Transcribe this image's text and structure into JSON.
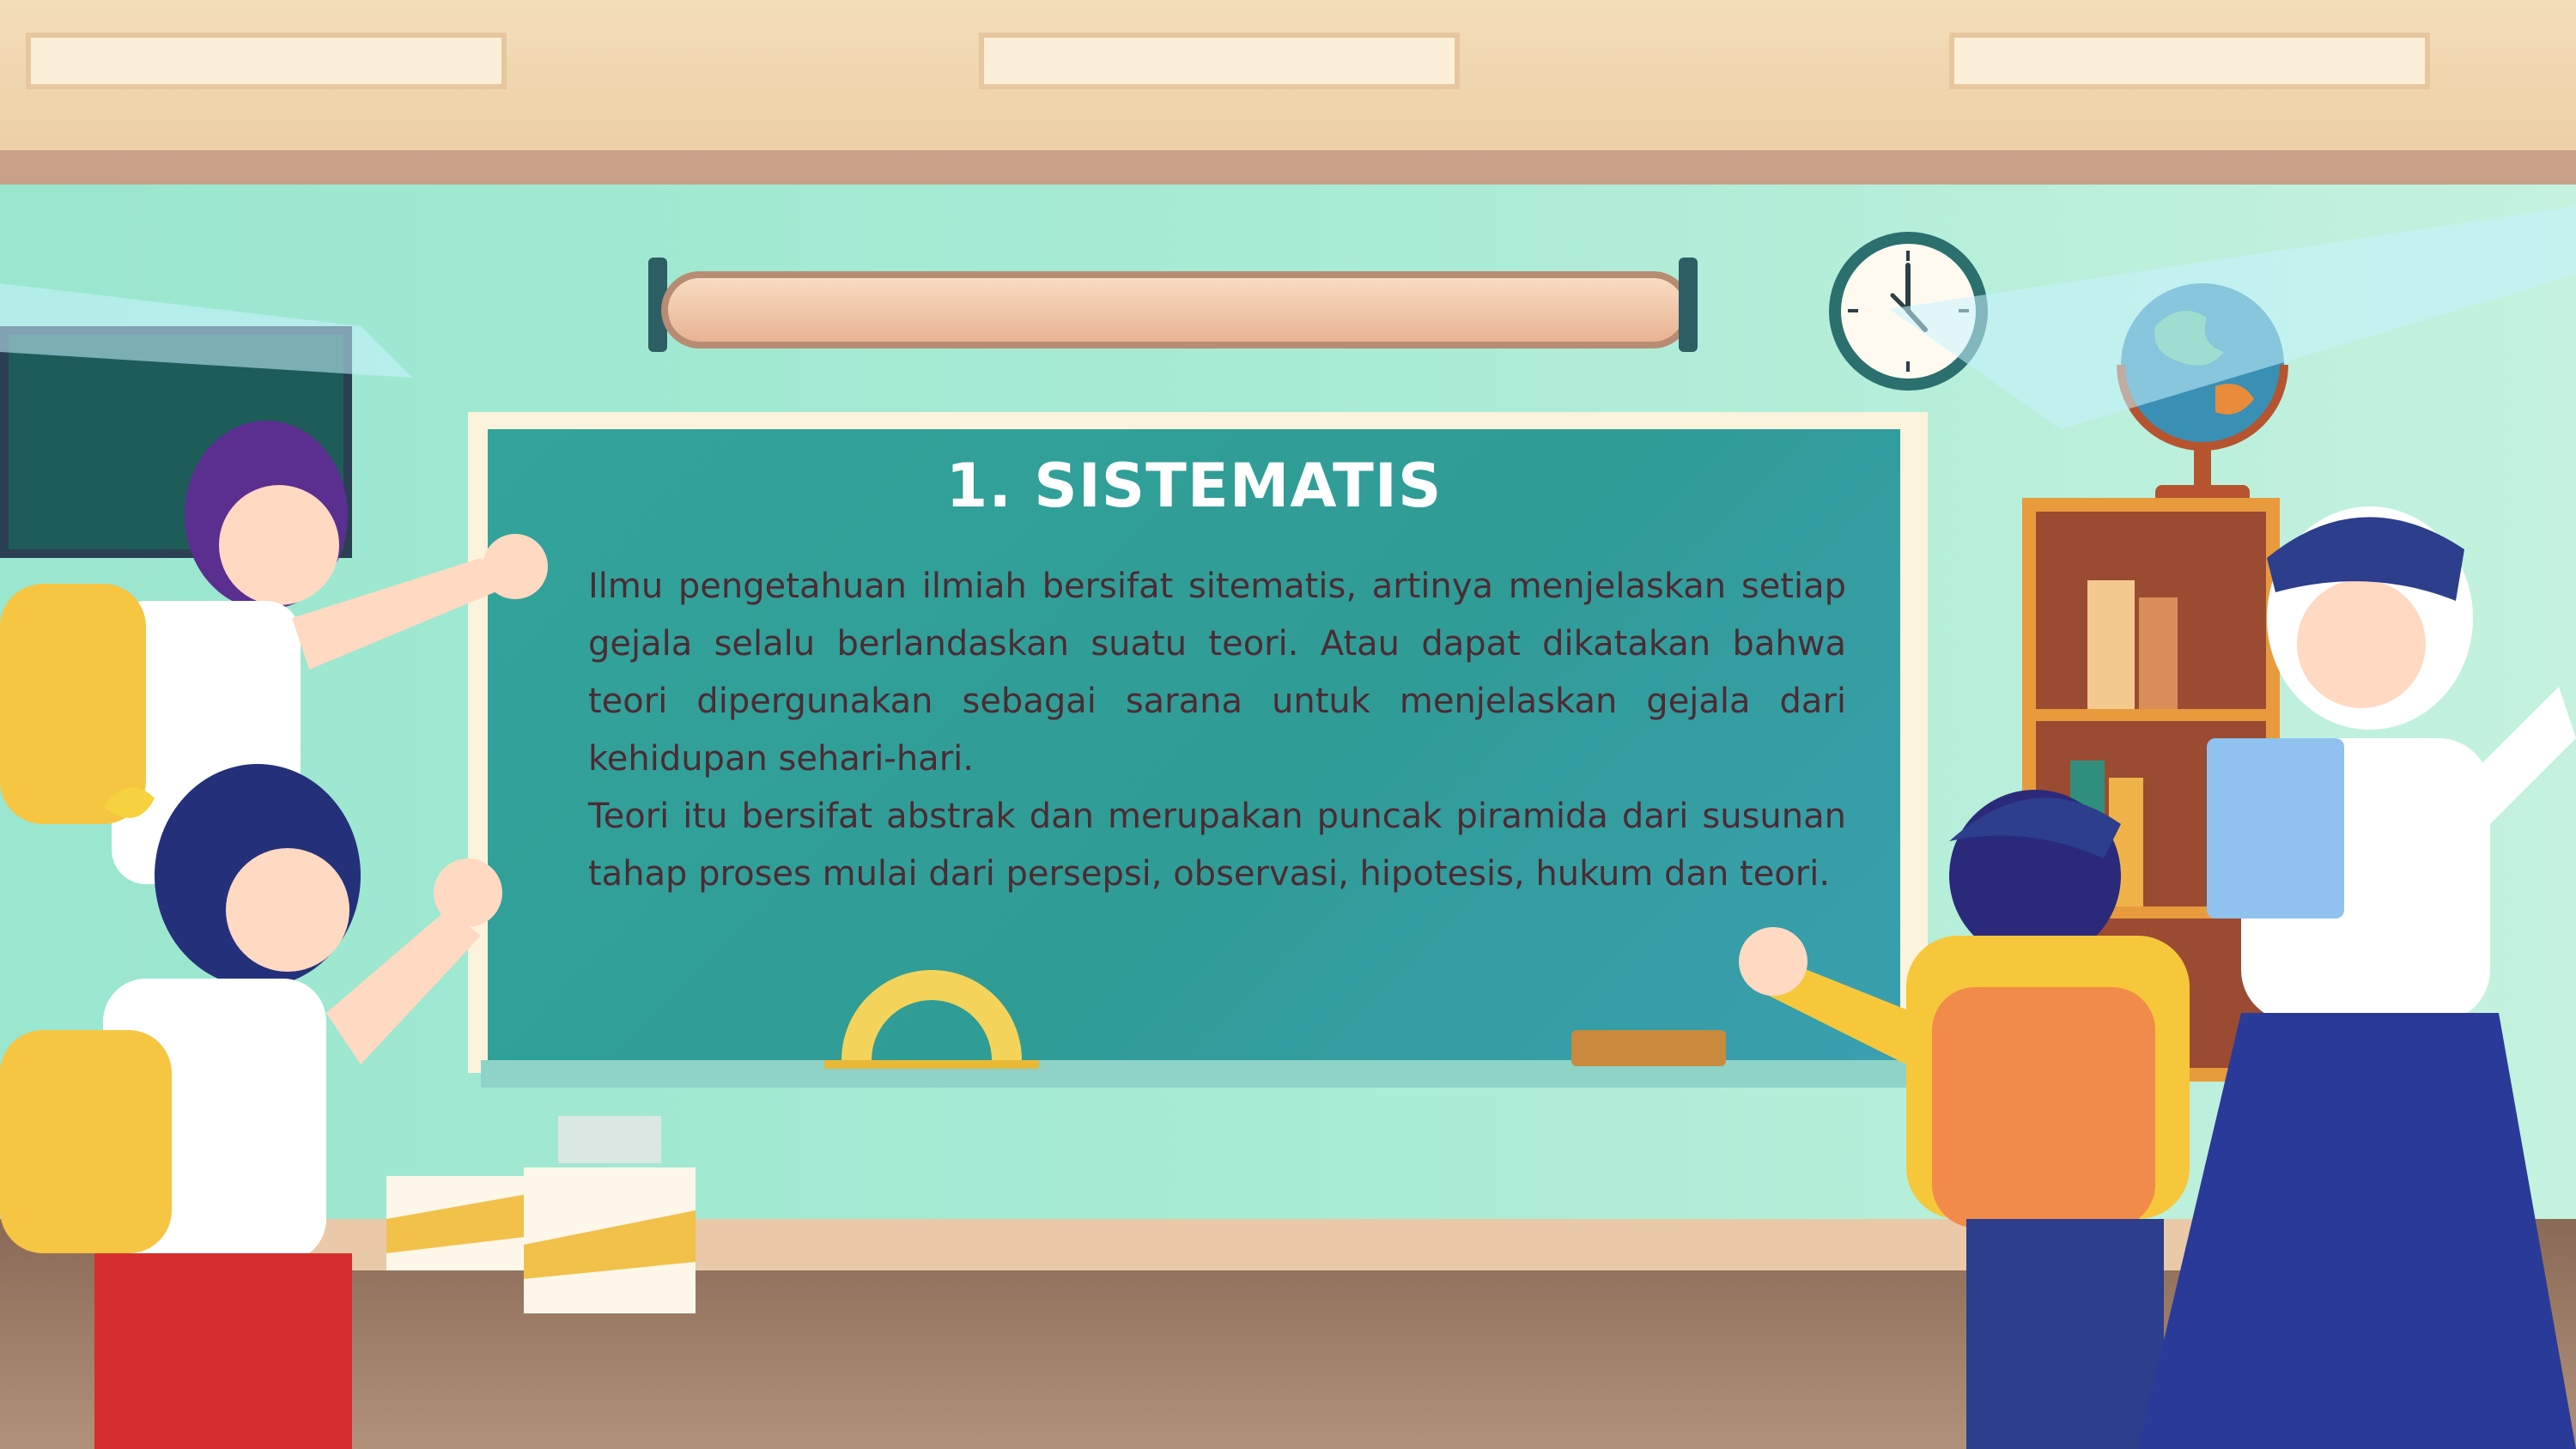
{
  "slide": {
    "title": "1. SISTEMATIS",
    "paragraph_1": "Ilmu pengetahuan ilmiah bersifat sitematis, artinya menjelaskan setiap gejala selalu berlandaskan suatu teori. Atau dapat dikatakan bahwa teori dipergunakan sebagai sarana untuk menjelaskan gejala dari kehidupan sehari-hari.",
    "paragraph_2": "Teori itu bersifat abstrak dan merupakan puncak piramida dari susunan tahap proses mulai dari persepsi, observasi, hipotesis, hukum dan teori."
  },
  "colors": {
    "wall": "#9fe3cc",
    "board": "#32a49b",
    "board_frame": "#fbf3dc",
    "title_text": "#ffffff",
    "body_text": "#4b2b33",
    "ceiling": "#f3ddb9"
  },
  "illustration": {
    "scene": "classroom",
    "icons": [
      "clock-icon",
      "globe-icon",
      "protractor-icon",
      "eraser-icon"
    ]
  }
}
